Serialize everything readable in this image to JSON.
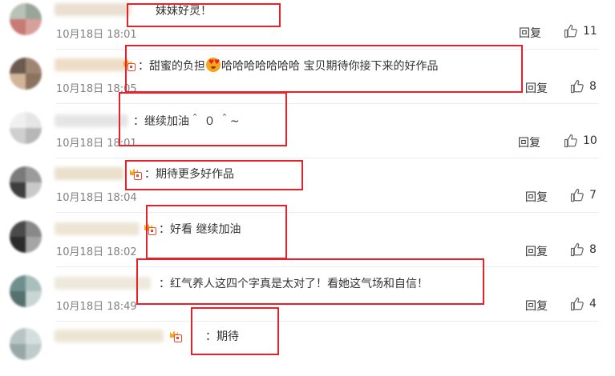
{
  "labels": {
    "reply": "回复"
  },
  "comments": [
    {
      "text": "妹妹好灵！",
      "time": "10月18日 18:01",
      "likes": "11",
      "badge": false
    },
    {
      "text_before": "：甜蜜的负担",
      "text_after": "哈哈哈哈哈哈哈 宝贝期待你接下来的好作品",
      "emoji": "heart-eyes-emoji",
      "time": "10月18日 18:05",
      "likes": "8",
      "badge": true
    },
    {
      "text": "：继续加油＾ ０ ＾~",
      "time": "10月18日 18:01",
      "likes": "10",
      "badge": false
    },
    {
      "text": "：期待更多好作品",
      "time": "10月18日 18:04",
      "likes": "7",
      "badge": true
    },
    {
      "text": "：好看 继续加油",
      "time": "10月18日 18:02",
      "likes": "8",
      "badge": true
    },
    {
      "text": "：红气养人这四个字真是太对了！看她这气场和自信！",
      "time": "10月18日 18:49",
      "likes": "4",
      "badge": false
    },
    {
      "text": "：期待",
      "time": "",
      "likes": "",
      "badge": true
    }
  ],
  "colors": {
    "highlight": "#e8202a",
    "meta": "#808080",
    "text": "#333333"
  },
  "icons": {
    "like": "thumbs-up-icon",
    "badge": "vip-crown-badge-icon"
  }
}
